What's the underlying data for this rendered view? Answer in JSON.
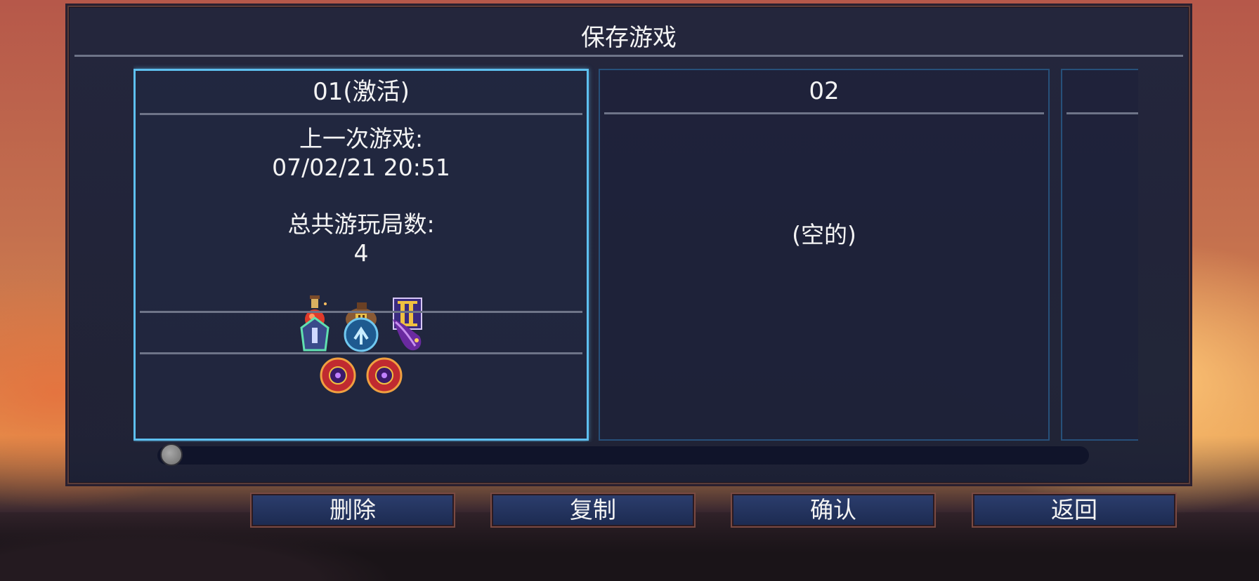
{
  "dialog": {
    "title": "保存游戏"
  },
  "slots": [
    {
      "header": "01(激活)",
      "last_played_label": "上一次游戏:",
      "last_played_value": "07/02/21  20:51",
      "runs_label": "总共游玩局数:",
      "runs_value": "4",
      "icons_row1": [
        "potion-flask-icon",
        "money-bag-tier-2-icon",
        "scroll-tier-2-icon"
      ],
      "icons_row2": [
        "green-rune-stone-icon",
        "blue-teleport-rune-icon",
        "purple-feather-icon"
      ],
      "icons_row3": [
        "red-boss-cell-icon",
        "red-boss-cell-icon"
      ],
      "active": true
    },
    {
      "header": "02",
      "empty_text": "(空的)",
      "active": false
    },
    {
      "header": "",
      "active": false
    }
  ],
  "scroll": {
    "position_fraction": 0.0
  },
  "buttons": {
    "delete": "删除",
    "copy": "复制",
    "confirm": "确认",
    "back": "返回"
  },
  "colors": {
    "active_border": "#5ec0f0",
    "inactive_border": "#27507a",
    "panel_bg": "#1e243c"
  }
}
